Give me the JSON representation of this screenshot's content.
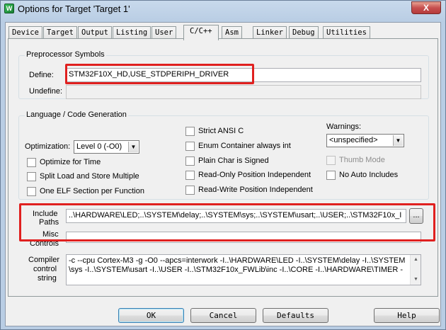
{
  "window": {
    "title": "Options for Target 'Target 1'",
    "close_glyph": "X",
    "icon_glyph": "W"
  },
  "tabs": [
    {
      "label": "Device"
    },
    {
      "label": "Target"
    },
    {
      "label": "Output"
    },
    {
      "label": "Listing"
    },
    {
      "label": "User"
    },
    {
      "label": "C/C++"
    },
    {
      "label": "Asm"
    },
    {
      "label": "Linker"
    },
    {
      "label": "Debug"
    },
    {
      "label": "Utilities"
    }
  ],
  "active_tab": "C/C++",
  "preprocessor": {
    "group_title": "Preprocessor Symbols",
    "define_label": "Define:",
    "define_value": "STM32F10X_HD,USE_STDPERIPH_DRIVER",
    "undefine_label": "Undefine:",
    "undefine_value": ""
  },
  "language": {
    "group_title": "Language / Code Generation",
    "optimization_label": "Optimization:",
    "optimization_value": "Level 0 (-O0)",
    "optimize_time": "Optimize for Time",
    "split_load_store": "Split Load and Store Multiple",
    "one_elf": "One ELF Section per Function",
    "strict_ansi": "Strict ANSI C",
    "enum_container": "Enum Container always int",
    "plain_char": "Plain Char is Signed",
    "ro_pos_indep": "Read-Only Position Independent",
    "rw_pos_indep": "Read-Write Position Independent",
    "warnings_label": "Warnings:",
    "warnings_value": "<unspecified>",
    "thumb_mode": "Thumb Mode",
    "no_auto_includes": "No Auto Includes"
  },
  "paths": {
    "include_label_1": "Include",
    "include_label_2": "Paths",
    "include_value": "..\\HARDWARE\\LED;..\\SYSTEM\\delay;..\\SYSTEM\\sys;..\\SYSTEM\\usart;..\\USER;..\\STM32F10x_I",
    "browse_label": "...",
    "misc_label_1": "Misc",
    "misc_label_2": "Controls",
    "misc_value": ""
  },
  "compiler": {
    "label_1": "Compiler",
    "label_2": "control",
    "label_3": "string",
    "line_1": "-c --cpu Cortex-M3 -g -O0 --apcs=interwork -I..\\HARDWARE\\LED -I..\\SYSTEM\\delay -I..\\SYSTEM",
    "line_2": "\\sys -I..\\SYSTEM\\usart -I..\\USER -I..\\STM32F10x_FWLib\\inc -I..\\CORE -I..\\HARDWARE\\TIMER -",
    "scroll_up": "▲",
    "scroll_down": "▼"
  },
  "buttons": {
    "ok": "OK",
    "cancel": "Cancel",
    "defaults": "Defaults",
    "help": "Help"
  },
  "colors": {
    "highlight_red": "#e0201f"
  }
}
